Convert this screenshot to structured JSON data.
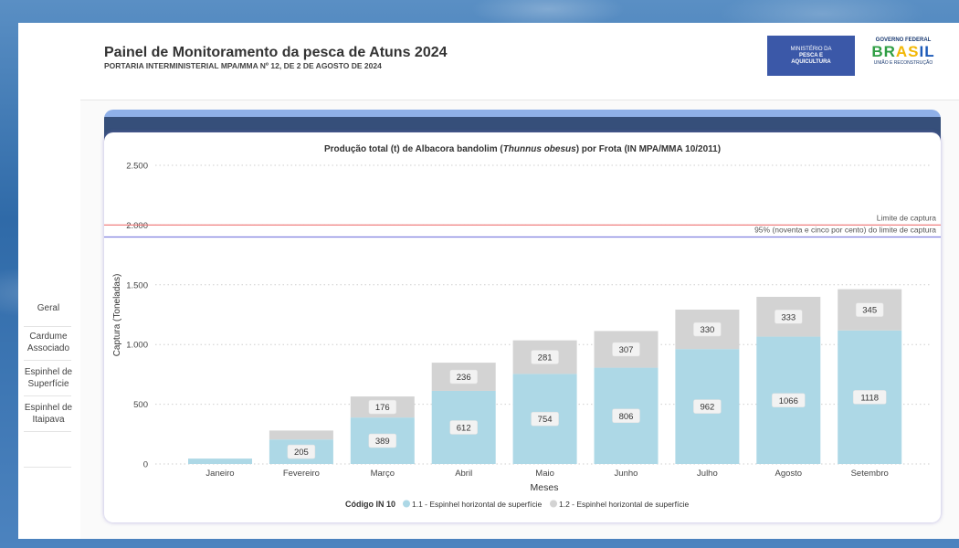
{
  "header": {
    "title": "Painel de Monitoramento da pesca de Atuns 2024",
    "subtitle": "PORTARIA INTERMINISTERIAL MPA/MMA Nº 12, DE 2 DE AGOSTO DE 2024",
    "logo_mpa": [
      "MINISTÉRIO DA",
      "PESCA E",
      "AQUICULTURA"
    ],
    "logo_gov_top": "GOVERNO FEDERAL",
    "logo_gov_word": "BRASIL",
    "logo_gov_bottom": "UNIÃO E RECONSTRUÇÃO"
  },
  "sidebar": {
    "items": [
      {
        "label": "Geral"
      },
      {
        "label": "Cardume Associado"
      },
      {
        "label": "Espinhel de Superfície"
      },
      {
        "label": "Espinhel de Itaipava"
      }
    ]
  },
  "colors": {
    "series1": "#add8e6",
    "series2": "#d3d3d3",
    "limit_line": "#f08080",
    "limit95_line": "#8080e0",
    "header_band": "#364f7a"
  },
  "chart_data": {
    "type": "bar",
    "stacked": true,
    "title_prefix": "Produção total (t) de Albacora bandolim (",
    "title_italic": "Thunnus obesus",
    "title_suffix": ") por Frota (IN MPA/MMA 10/2011)",
    "xlabel": "Meses",
    "ylabel": "Captura (Toneladas)",
    "ylim": [
      0,
      2500
    ],
    "yticks": [
      0,
      500,
      1000,
      1500,
      2000,
      2500
    ],
    "ytick_labels": [
      "0",
      "500",
      "1.000",
      "1.500",
      "2.000",
      "2.500"
    ],
    "grid": true,
    "categories": [
      "Janeiro",
      "Fevereiro",
      "Março",
      "Abril",
      "Maio",
      "Junho",
      "Julho",
      "Agosto",
      "Setembro"
    ],
    "series": [
      {
        "name": "1.1 - Espinhel horizontal de superfície",
        "values": [
          45,
          205,
          389,
          612,
          754,
          806,
          962,
          1066,
          1118
        ]
      },
      {
        "name": "1.2 - Espinhel horizontal de superfície",
        "values": [
          0,
          75,
          176,
          236,
          281,
          307,
          330,
          333,
          345
        ]
      }
    ],
    "data_labels": {
      "series1": [
        "",
        "205",
        "389",
        "612",
        "754",
        "806",
        "962",
        "1066",
        "1118"
      ],
      "series2": [
        "",
        "",
        "176",
        "236",
        "281",
        "307",
        "330",
        "333",
        "345"
      ]
    },
    "reference_lines": [
      {
        "label": "Limite de captura",
        "value": 2000
      },
      {
        "label": "95% (noventa e cinco por cento) do limite de captura",
        "value": 1900
      }
    ],
    "legend": {
      "title": "Código IN 10",
      "placement": "bottom-center"
    }
  }
}
